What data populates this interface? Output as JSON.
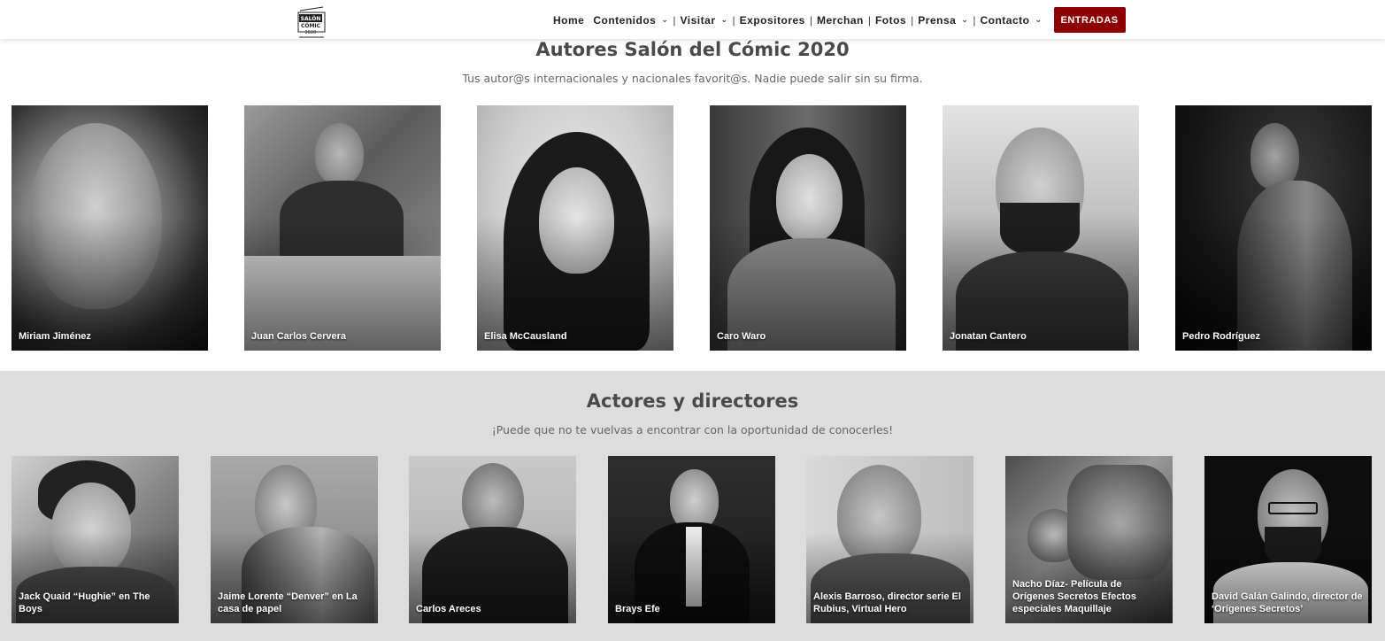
{
  "nav": {
    "items": [
      {
        "label": "Home",
        "dropdown": false
      },
      {
        "label": "Contenidos",
        "dropdown": true
      },
      {
        "label": "Visitar",
        "dropdown": true
      },
      {
        "label": "Expositores",
        "dropdown": false
      },
      {
        "label": "Merchan",
        "dropdown": false
      },
      {
        "label": "Fotos",
        "dropdown": false
      },
      {
        "label": "Prensa",
        "dropdown": true
      },
      {
        "label": "Contacto",
        "dropdown": true
      }
    ],
    "cta_label": "ENTRADAS",
    "cta_color": "#8b0000"
  },
  "logo": {
    "icon": "salon-del-comic-logo-icon",
    "text_top": "SALÓN",
    "text_mid": "CÓMIC",
    "text_year": "2020"
  },
  "authors": {
    "title": "Autores Salón del Cómic 2020",
    "subtitle": "Tus autor@s internacionales y nacionales favorit@s. Nadie puede salir sin su firma.",
    "people": [
      {
        "name": "Miriam Jiménez"
      },
      {
        "name": "Juan Carlos Cervera"
      },
      {
        "name": "Elisa McCausland"
      },
      {
        "name": "Caro Waro"
      },
      {
        "name": "Jonatan Cantero"
      },
      {
        "name": "Pedro Rodríguez"
      }
    ]
  },
  "actors": {
    "title": "Actores y directores",
    "subtitle": "¡Puede que no te vuelvas a encontrar con la oportunidad de conocerles!",
    "people": [
      {
        "name": "Jack Quaid “Hughie” en The Boys"
      },
      {
        "name": "Jaime Lorente “Denver” en La casa de papel"
      },
      {
        "name": "Carlos Areces"
      },
      {
        "name": "Brays Efe"
      },
      {
        "name": "Alexis Barroso, director serie El Rubius, Virtual Hero"
      },
      {
        "name": "Nacho Díaz- Película de Orígenes Secretos Efectos especiales Maquillaje"
      },
      {
        "name": "David Galán Galindo, director de ‘Orígenes Secretos’"
      }
    ]
  },
  "colors": {
    "section_bg_alt": "#dddddd",
    "title": "#4a4a4a"
  }
}
